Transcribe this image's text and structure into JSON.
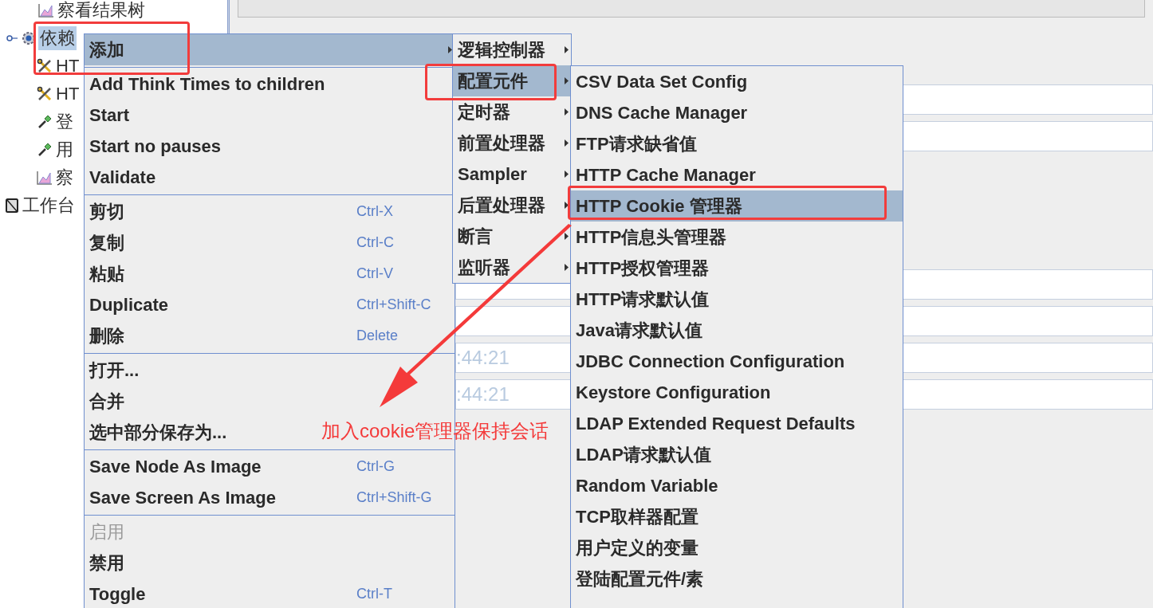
{
  "tree": {
    "hidden_parent_children": [
      {
        "label": "察看结果树",
        "kind": "chart",
        "selected": false
      }
    ],
    "groups": [
      {
        "label": "依赖",
        "kind": "gear",
        "selected": true,
        "children": [
          {
            "label": "HT",
            "kind": "tools",
            "selected": false
          },
          {
            "label": "HT",
            "kind": "tools",
            "selected": false
          },
          {
            "label": "登",
            "kind": "dropper",
            "selected": false
          },
          {
            "label": "用",
            "kind": "dropper",
            "selected": false
          },
          {
            "label": "察",
            "kind": "chart",
            "selected": false
          }
        ]
      }
    ],
    "root_items": [
      {
        "label": "工作台",
        "kind": "notebook",
        "selected": false
      }
    ]
  },
  "fields": [
    {
      "value": ":44:21"
    },
    {
      "value": ":44:21"
    }
  ],
  "context_menu": {
    "items": [
      {
        "kind": "item",
        "label": "添加",
        "submenu": true,
        "selected": true,
        "disabled": false
      },
      {
        "kind": "separator"
      },
      {
        "kind": "item",
        "label": "Add Think Times to children",
        "selected": false,
        "disabled": false
      },
      {
        "kind": "item",
        "label": "Start",
        "selected": false,
        "disabled": false
      },
      {
        "kind": "item",
        "label": "Start no pauses",
        "selected": false,
        "disabled": false
      },
      {
        "kind": "item",
        "label": "Validate",
        "selected": false,
        "disabled": false
      },
      {
        "kind": "separator"
      },
      {
        "kind": "item",
        "label": "剪切",
        "shortcut": "Ctrl-X",
        "selected": false,
        "disabled": false
      },
      {
        "kind": "item",
        "label": "复制",
        "shortcut": "Ctrl-C",
        "selected": false,
        "disabled": false
      },
      {
        "kind": "item",
        "label": "粘贴",
        "shortcut": "Ctrl-V",
        "selected": false,
        "disabled": false
      },
      {
        "kind": "item",
        "label": "Duplicate",
        "shortcut": "Ctrl+Shift-C",
        "selected": false,
        "disabled": false
      },
      {
        "kind": "item",
        "label": "删除",
        "shortcut": "Delete",
        "selected": false,
        "disabled": false
      },
      {
        "kind": "separator"
      },
      {
        "kind": "item",
        "label": "打开...",
        "selected": false,
        "disabled": false
      },
      {
        "kind": "item",
        "label": "合并",
        "selected": false,
        "disabled": false
      },
      {
        "kind": "item",
        "label": "选中部分保存为...",
        "selected": false,
        "disabled": false
      },
      {
        "kind": "separator"
      },
      {
        "kind": "item",
        "label": "Save Node As Image",
        "shortcut": "Ctrl-G",
        "selected": false,
        "disabled": false
      },
      {
        "kind": "item",
        "label": "Save Screen As Image",
        "shortcut": "Ctrl+Shift-G",
        "selected": false,
        "disabled": false
      },
      {
        "kind": "separator"
      },
      {
        "kind": "item",
        "label": "启用",
        "selected": false,
        "disabled": true
      },
      {
        "kind": "item",
        "label": "禁用",
        "selected": false,
        "disabled": false
      },
      {
        "kind": "item",
        "label": "Toggle",
        "shortcut": "Ctrl-T",
        "selected": false,
        "disabled": false
      }
    ]
  },
  "add_submenu": {
    "items": [
      {
        "kind": "item",
        "label": "逻辑控制器",
        "submenu": true,
        "selected": false,
        "disabled": false
      },
      {
        "kind": "item",
        "label": "配置元件",
        "submenu": true,
        "selected": true,
        "disabled": false
      },
      {
        "kind": "item",
        "label": "定时器",
        "submenu": true,
        "selected": false,
        "disabled": false
      },
      {
        "kind": "item",
        "label": "前置处理器",
        "submenu": true,
        "selected": false,
        "disabled": false
      },
      {
        "kind": "item",
        "label": "Sampler",
        "submenu": true,
        "selected": false,
        "disabled": false
      },
      {
        "kind": "item",
        "label": "后置处理器",
        "submenu": true,
        "selected": false,
        "disabled": false
      },
      {
        "kind": "item",
        "label": "断言",
        "submenu": true,
        "selected": false,
        "disabled": false
      },
      {
        "kind": "item",
        "label": "监听器",
        "submenu": true,
        "selected": false,
        "disabled": false
      }
    ]
  },
  "config_submenu": {
    "items": [
      {
        "kind": "item",
        "label": "CSV Data Set Config",
        "selected": false,
        "disabled": false
      },
      {
        "kind": "item",
        "label": "DNS Cache Manager",
        "selected": false,
        "disabled": false
      },
      {
        "kind": "item",
        "label": "FTP请求缺省值",
        "selected": false,
        "disabled": false
      },
      {
        "kind": "item",
        "label": "HTTP Cache Manager",
        "selected": false,
        "disabled": false
      },
      {
        "kind": "item",
        "label": "HTTP Cookie 管理器",
        "selected": true,
        "disabled": false
      },
      {
        "kind": "item",
        "label": "HTTP信息头管理器",
        "selected": false,
        "disabled": false
      },
      {
        "kind": "item",
        "label": "HTTP授权管理器",
        "selected": false,
        "disabled": false
      },
      {
        "kind": "item",
        "label": "HTTP请求默认值",
        "selected": false,
        "disabled": false
      },
      {
        "kind": "item",
        "label": "Java请求默认值",
        "selected": false,
        "disabled": false
      },
      {
        "kind": "item",
        "label": "JDBC Connection Configuration",
        "selected": false,
        "disabled": false
      },
      {
        "kind": "item",
        "label": "Keystore Configuration",
        "selected": false,
        "disabled": false
      },
      {
        "kind": "item",
        "label": "LDAP Extended Request Defaults",
        "selected": false,
        "disabled": false
      },
      {
        "kind": "item",
        "label": "LDAP请求默认值",
        "selected": false,
        "disabled": false
      },
      {
        "kind": "item",
        "label": "Random Variable",
        "selected": false,
        "disabled": false
      },
      {
        "kind": "item",
        "label": "TCP取样器配置",
        "selected": false,
        "disabled": false
      },
      {
        "kind": "item",
        "label": "用户定义的变量",
        "selected": false,
        "disabled": false
      },
      {
        "kind": "item",
        "label": "登陆配置元件/素",
        "selected": false,
        "disabled": false
      }
    ]
  },
  "annotation": {
    "text": "加入cookie管理器保持会话"
  }
}
